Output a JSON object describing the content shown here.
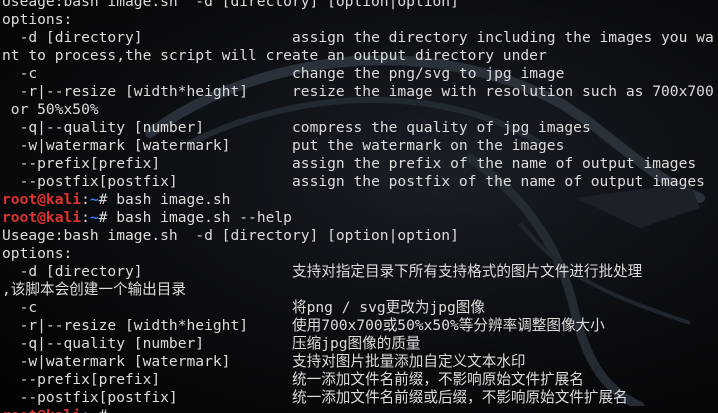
{
  "prompt": {
    "user": "root@kali",
    "sep": ":",
    "path": "~",
    "symbol": "# "
  },
  "lines_top": [
    {
      "text": "Useage:bash image.sh  -d [directory] [option|option]"
    },
    {
      "text": "options:"
    },
    {
      "text": "  -d [directory]",
      "desc": "assign the directory including the images you wa"
    },
    {
      "text": "nt to process,the script will create an output directory under"
    },
    {
      "text": "  -c",
      "desc": "change the png/svg to jpg image"
    },
    {
      "text": "  -r|--resize [width*height]",
      "desc": "resize the image with resolution such as 700x700"
    },
    {
      "text": " or 50%x50%"
    },
    {
      "text": "  -q|--quality [number]",
      "desc": "compress the quality of jpg images"
    },
    {
      "text": "  -w|watermark [watermark]",
      "desc": "put the watermark on the images"
    },
    {
      "text": "  --prefix[prefix]",
      "desc": "assign the prefix of the name of output images"
    },
    {
      "text": "  --postfix[postfix]",
      "desc": "assign the postfix of the name of output images"
    }
  ],
  "commands": [
    "bash image.sh",
    "bash image.sh --help",
    ""
  ],
  "lines_bottom": [
    {
      "text": "Useage:bash image.sh  -d [directory] [option|option]"
    },
    {
      "text": "options:"
    },
    {
      "text": "  -d [directory]",
      "desc": "支持对指定目录下所有支持格式的图片文件进行批处理"
    },
    {
      "text": ",该脚本会创建一个输出目录"
    },
    {
      "text": "  -c",
      "desc": "将png / svg更改为jpg图像"
    },
    {
      "text": "  -r|--resize [width*height]",
      "desc": "使用700x700或50%x50%等分辨率调整图像大小"
    },
    {
      "text": "  -q|--quality [number]",
      "desc": "压缩jpg图像的质量"
    },
    {
      "text": "  -w|watermark [watermark]",
      "desc": "支持对图片批量添加自定义文本水印"
    },
    {
      "text": "  --prefix[prefix]",
      "desc": "统一添加文件名前缀，不影响原始文件扩展名"
    },
    {
      "text": "  --postfix[postfix]",
      "desc": "统一添加文件名前缀或后缀，不影响原始文件扩展名"
    }
  ]
}
